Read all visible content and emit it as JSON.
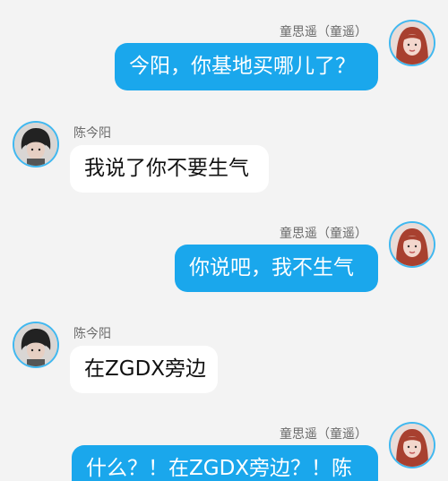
{
  "colors": {
    "outgoing_bubble": "#1aa7ec",
    "incoming_bubble": "#ffffff",
    "avatar_ring": "#40b8f0",
    "background": "#f3f3f3"
  },
  "messages": [
    {
      "sender": "童思遥（童遥）",
      "text": "今阳，你基地买哪儿了？",
      "direction": "outgoing",
      "avatar_icon": "female-avatar-icon"
    },
    {
      "sender": "陈今阳",
      "text": "我说了你不要生气",
      "direction": "incoming",
      "avatar_icon": "male-avatar-icon"
    },
    {
      "sender": "童思遥（童遥）",
      "text": "你说吧，我不生气",
      "direction": "outgoing",
      "avatar_icon": "female-avatar-icon"
    },
    {
      "sender": "陈今阳",
      "text": "在ZGDX旁边",
      "direction": "incoming",
      "avatar_icon": "male-avatar-icon"
    },
    {
      "sender": "童思遥（童遥）",
      "text": "什么？！在ZGDX旁边？！陈",
      "direction": "outgoing",
      "avatar_icon": "female-avatar-icon"
    }
  ]
}
